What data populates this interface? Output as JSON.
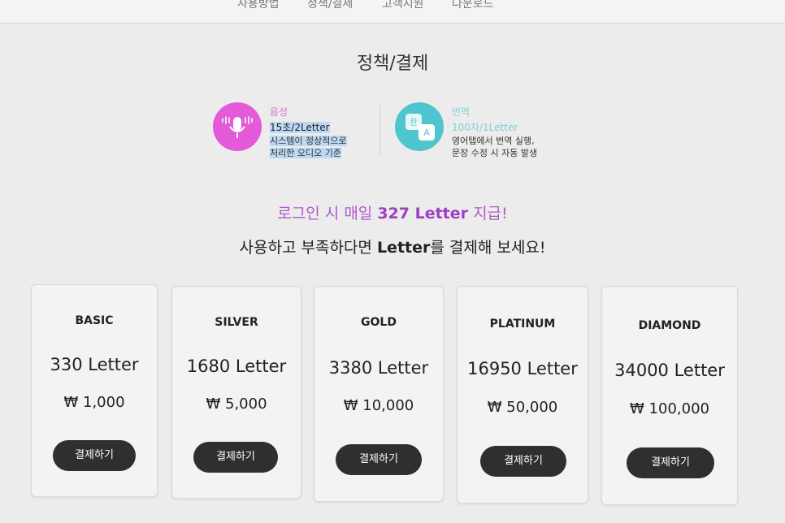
{
  "nav": {
    "items": [
      "사용방법",
      "정책/결제",
      "고객지원",
      "다운로드"
    ]
  },
  "page": {
    "title": "정책/결제"
  },
  "features": {
    "voice": {
      "title": "음성",
      "rate": "15초/2Letter",
      "desc_line1": "시스템이 정상적으로",
      "desc_line2": "처리한 오디오 기준",
      "icon": "microphone-icon",
      "color": "#e45ad9"
    },
    "translate": {
      "title": "번역",
      "rate": "100자/1Letter",
      "desc_line1": "영어탭에서 번역 실행,",
      "desc_line2": "문장 수정 시 자동 발생",
      "icon": "translate-icon",
      "color": "#4fc6cf"
    }
  },
  "promo": {
    "prefix": "로그인 시 매일 ",
    "amount": "327 Letter",
    "suffix": "  지급!"
  },
  "subline": {
    "prefix": "사용하고 부족하다면 ",
    "bold": "Letter",
    "suffix": "를 결제해 보세요!"
  },
  "plans": [
    {
      "name": "BASIC",
      "letters": "330 Letter",
      "price": "₩ 1,000",
      "button": "결제하기"
    },
    {
      "name": "SILVER",
      "letters": "1680 Letter",
      "price": "₩ 5,000",
      "button": "결제하기"
    },
    {
      "name": "GOLD",
      "letters": "3380 Letter",
      "price": "₩ 10,000",
      "button": "결제하기"
    },
    {
      "name": "PLATINUM",
      "letters": "16950 Letter",
      "price": "₩ 50,000",
      "button": "결제하기"
    },
    {
      "name": "DIAMOND",
      "letters": "34000 Letter",
      "price": "₩ 100,000",
      "button": "결제하기"
    }
  ],
  "colors": {
    "promo": "#b05acb",
    "button": "#2f2f2f",
    "highlight": "#bcd8f3"
  }
}
